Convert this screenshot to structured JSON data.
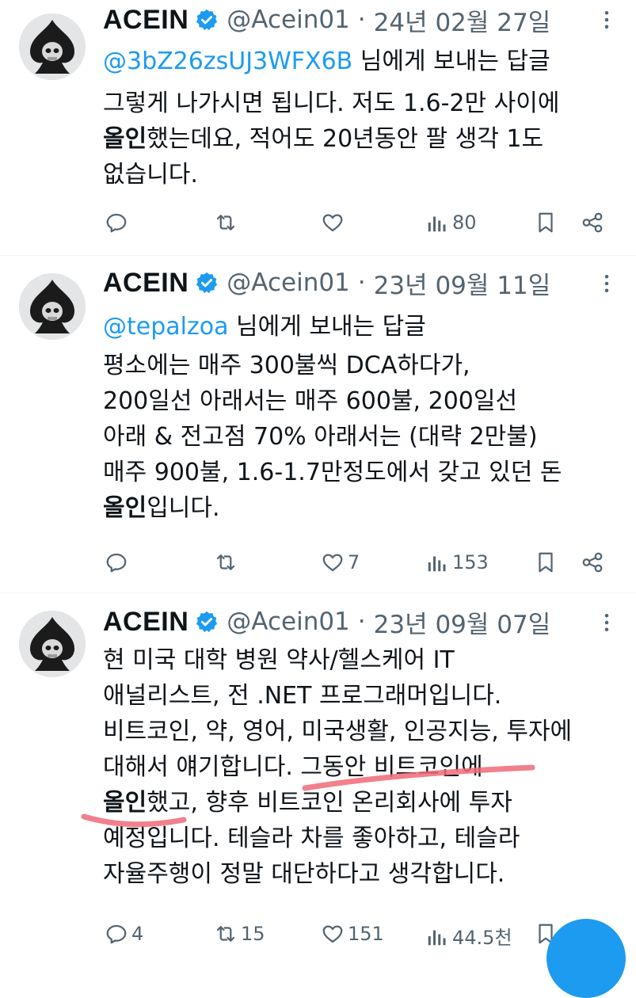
{
  "colors": {
    "accent": "#1d9bf0",
    "muted": "#536471",
    "text": "#0f1419",
    "underline": "#f06a78"
  },
  "tweets": [
    {
      "name": "ACEIN",
      "handle": "@Acein01",
      "separator": "·",
      "date": "24년 02월 27일",
      "reply_mention": "@3bZ26zsUJ3WFX6B",
      "reply_suffix": " 님에게 보내는 답글",
      "line1": "그렇게 나가시면 됩니다. 저도 1.6-2만 사이에",
      "line2_bold": "올인",
      "line2_rest": "했는데요, 적어도 20년동안 팔 생각 1도",
      "line3": "없습니다.",
      "replies": "",
      "retweets": "",
      "likes": "",
      "views": "80"
    },
    {
      "name": "ACEIN",
      "handle": "@Acein01",
      "separator": "·",
      "date": "23년 09월 11일",
      "reply_mention": "@tepalzoa",
      "reply_suffix": " 님에게 보내는 답글",
      "line1": "평소에는 매주 300불씩 DCA하다가,",
      "line2": "200일선 아래서는 매주 600불, 200일선",
      "line3": "아래 & 전고점 70% 아래서는 (대략 2만불)",
      "line4": "매주 900불, 1.6-1.7만정도에서 갖고 있던 돈",
      "line5_bold": "올인",
      "line5_rest": "입니다.",
      "replies": "",
      "retweets": "",
      "likes": "7",
      "views": "153"
    },
    {
      "name": "ACEIN",
      "handle": "@Acein01",
      "separator": "·",
      "date": "23년 09월 07일",
      "line1": "현 미국 대학 병원 약사/헬스케어 IT",
      "line2": "애널리스트, 전 .NET 프로그래머입니다.",
      "line3": "비트코인, 약, 영어, 미국생활, 인공지능, 투자에",
      "line4": "대해서 얘기합니다. 그동안 비트코인에",
      "line5_bold": "올인",
      "line5_rest": "했고, 향후 비트코인 온리회사에 투자",
      "line6": "예정입니다. 테슬라 차를 좋아하고, 테슬라",
      "line7": "자율주행이 정말 대단하다고 생각합니다.",
      "replies": "4",
      "retweets": "15",
      "likes": "151",
      "views": "44.5천"
    }
  ]
}
